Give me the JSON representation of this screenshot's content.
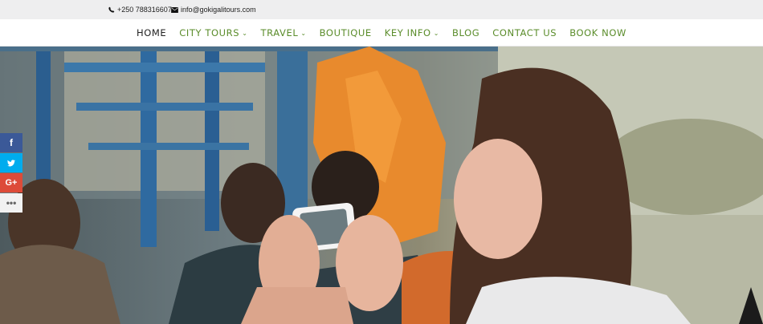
{
  "topbar": {
    "phone": "+250 788316607",
    "email": "info@gokigalitours.com",
    "phone_icon": "phone-icon",
    "email_icon": "envelope-icon"
  },
  "nav": {
    "items": [
      {
        "label": "HOME",
        "dropdown": false
      },
      {
        "label": "CITY TOURS",
        "dropdown": true
      },
      {
        "label": "TRAVEL",
        "dropdown": true
      },
      {
        "label": "BOUTIQUE",
        "dropdown": false
      },
      {
        "label": "KEY INFO",
        "dropdown": true
      },
      {
        "label": "BLOG",
        "dropdown": false
      },
      {
        "label": "CONTACT US",
        "dropdown": false
      },
      {
        "label": "BOOK NOW",
        "dropdown": false
      }
    ],
    "accent_color": "#5a8c2a",
    "active_color": "#222222"
  },
  "social": {
    "items": [
      {
        "icon": "facebook-icon",
        "glyph": "f",
        "color": "#3b5998"
      },
      {
        "icon": "twitter-icon",
        "glyph": "🐦",
        "color": "#00acee"
      },
      {
        "icon": "google-plus-icon",
        "glyph": "G+",
        "color": "#dd4b39"
      },
      {
        "icon": "more-icon",
        "glyph": "•••",
        "color": "#f2f2f2"
      }
    ]
  }
}
